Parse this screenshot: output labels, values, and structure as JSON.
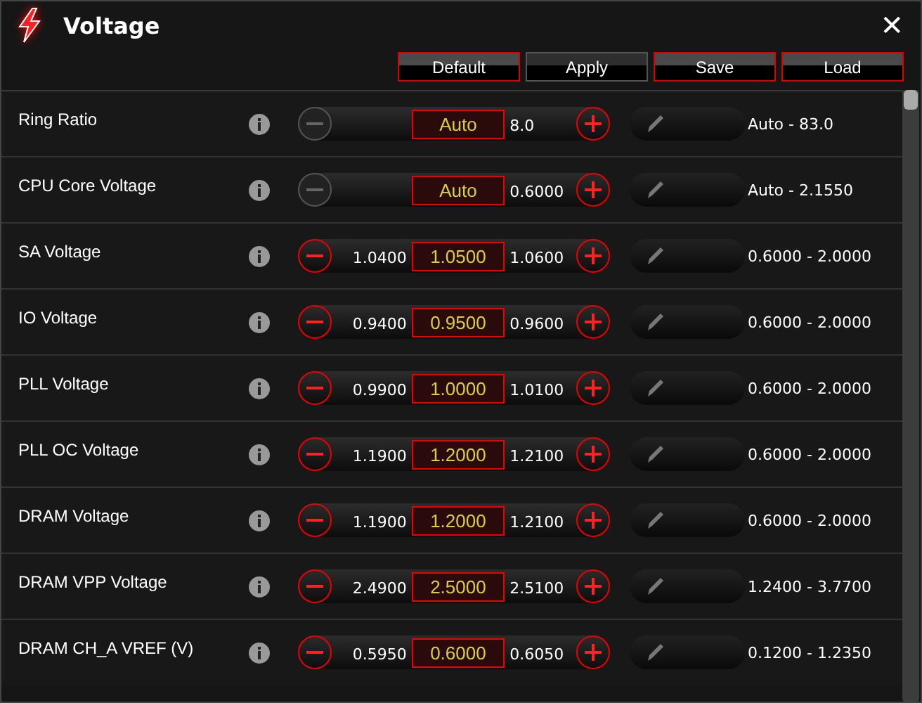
{
  "window": {
    "title": "Voltage",
    "close": "✕"
  },
  "buttons": [
    {
      "label": "Default",
      "disabled": false
    },
    {
      "label": "Apply",
      "disabled": true
    },
    {
      "label": "Save",
      "disabled": false
    },
    {
      "label": "Load",
      "disabled": false
    }
  ],
  "rows": [
    {
      "name": "Ring Ratio",
      "value": "Auto",
      "upper": "8.0",
      "range": "Auto - 83.0",
      "minus_disabled": true
    },
    {
      "name": "CPU Core Voltage",
      "value": "Auto",
      "upper": "0.6000",
      "range": "Auto - 2.1550",
      "minus_disabled": true
    },
    {
      "name": "SA Voltage",
      "lower": "1.0400",
      "value": "1.0500",
      "upper": "1.0600",
      "range": "0.6000 - 2.0000",
      "minus_disabled": false
    },
    {
      "name": "IO Voltage",
      "lower": "0.9400",
      "value": "0.9500",
      "upper": "0.9600",
      "range": "0.6000 - 2.0000",
      "minus_disabled": false
    },
    {
      "name": "PLL Voltage",
      "lower": "0.9900",
      "value": "1.0000",
      "upper": "1.0100",
      "range": "0.6000 - 2.0000",
      "minus_disabled": false
    },
    {
      "name": "PLL OC Voltage",
      "lower": "1.1900",
      "value": "1.2000",
      "upper": "1.2100",
      "range": "0.6000 - 2.0000",
      "minus_disabled": false
    },
    {
      "name": "DRAM Voltage",
      "lower": "1.1900",
      "value": "1.2000",
      "upper": "1.2100",
      "range": "0.6000 - 2.0000",
      "minus_disabled": false
    },
    {
      "name": "DRAM VPP Voltage",
      "lower": "2.4900",
      "value": "2.5000",
      "upper": "2.5100",
      "range": "1.2400 - 3.7700",
      "minus_disabled": false
    },
    {
      "name": "DRAM CH_A VREF (V)",
      "lower": "0.5950",
      "value": "0.6000",
      "upper": "0.6050",
      "range": "0.1200 - 1.2350",
      "minus_disabled": false
    }
  ]
}
